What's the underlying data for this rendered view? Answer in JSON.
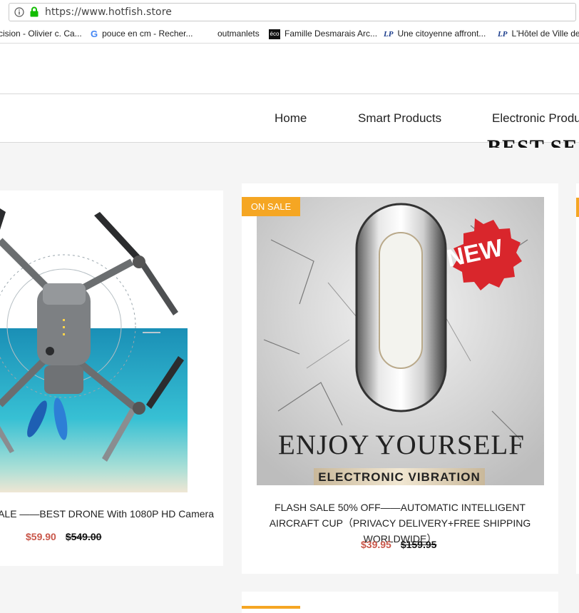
{
  "browser": {
    "url": "https://www.hotfish.store",
    "bookmarks": [
      {
        "label": "cision - Olivier c. Ca...",
        "icon": "none"
      },
      {
        "label": "pouce en cm - Recher...",
        "icon": "google-icon"
      },
      {
        "label": "outmanlets",
        "icon": "none"
      },
      {
        "label": "Famille Desmarais Arc...",
        "icon": "eco-icon"
      },
      {
        "label": "Une citoyenne affront...",
        "icon": "lp-icon"
      },
      {
        "label": "L'Hôtel de Ville de",
        "icon": "lp-icon"
      }
    ]
  },
  "nav": {
    "items": [
      "Home",
      "Smart Products",
      "Electronic Produ"
    ]
  },
  "section": {
    "title": "BEST SE"
  },
  "products": [
    {
      "title": "ALE ——BEST DRONE With 1080P HD Camera",
      "price": "$59.90",
      "old_price": "$549.00"
    },
    {
      "badge": "ON SALE",
      "title": "FLASH SALE 50% OFF——AUTOMATIC INTELLIGENT AIRCRAFT CUP（PRIVACY DELIVERY+FREE SHIPPING WORLDWIDE）",
      "price": "$39.95",
      "old_price": "$159.95",
      "image_text": {
        "headline": "ENJOY YOURSELF",
        "subline": "ELECTRONIC VIBRATION",
        "sticker": "NEW"
      }
    }
  ],
  "colors": {
    "badge": "#f5a623",
    "sale_price": "#c9574a"
  }
}
